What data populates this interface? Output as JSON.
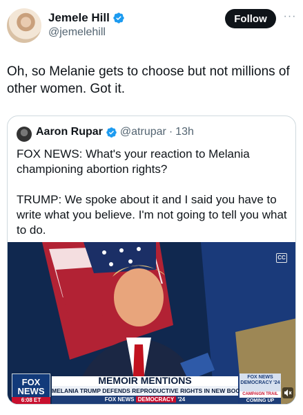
{
  "author": {
    "name": "Jemele Hill",
    "handle": "@jemelehill"
  },
  "follow_label": "Follow",
  "more_label": "···",
  "tweet_text": "Oh, so Melanie gets to choose but not millions of other women. Got it.",
  "quote": {
    "name": "Aaron Rupar",
    "handle": "@atrupar",
    "separator": "·",
    "time": "13h",
    "text": "FOX NEWS: What's your reaction to Melania championing abortion rights?\n\nTRUMP: We spoke about it and I said you have to write what you believe. I'm not going to tell you what to do."
  },
  "video": {
    "badge": "CC",
    "logo": "FOX NEWS",
    "clock": "6:08 ET",
    "headline": "MEMOIR MENTIONS",
    "subheadline": "MELANIA TRUMP DEFENDS REPRODUCTIVE RIGHTS IN NEW BOOK",
    "strip_brand": "FOX NEWS",
    "strip_tag": "DEMOCRACY",
    "strip_year": "'24",
    "side_top": "FOX NEWS DEMOCRACY '24",
    "side_mid": "CAMPAIGN TRAIL",
    "side_bottom": "COMING UP"
  },
  "colors": {
    "verified": "#1d9bf0",
    "follow_bg": "#0f1419",
    "border": "#cfd9de",
    "muted": "#536471"
  }
}
